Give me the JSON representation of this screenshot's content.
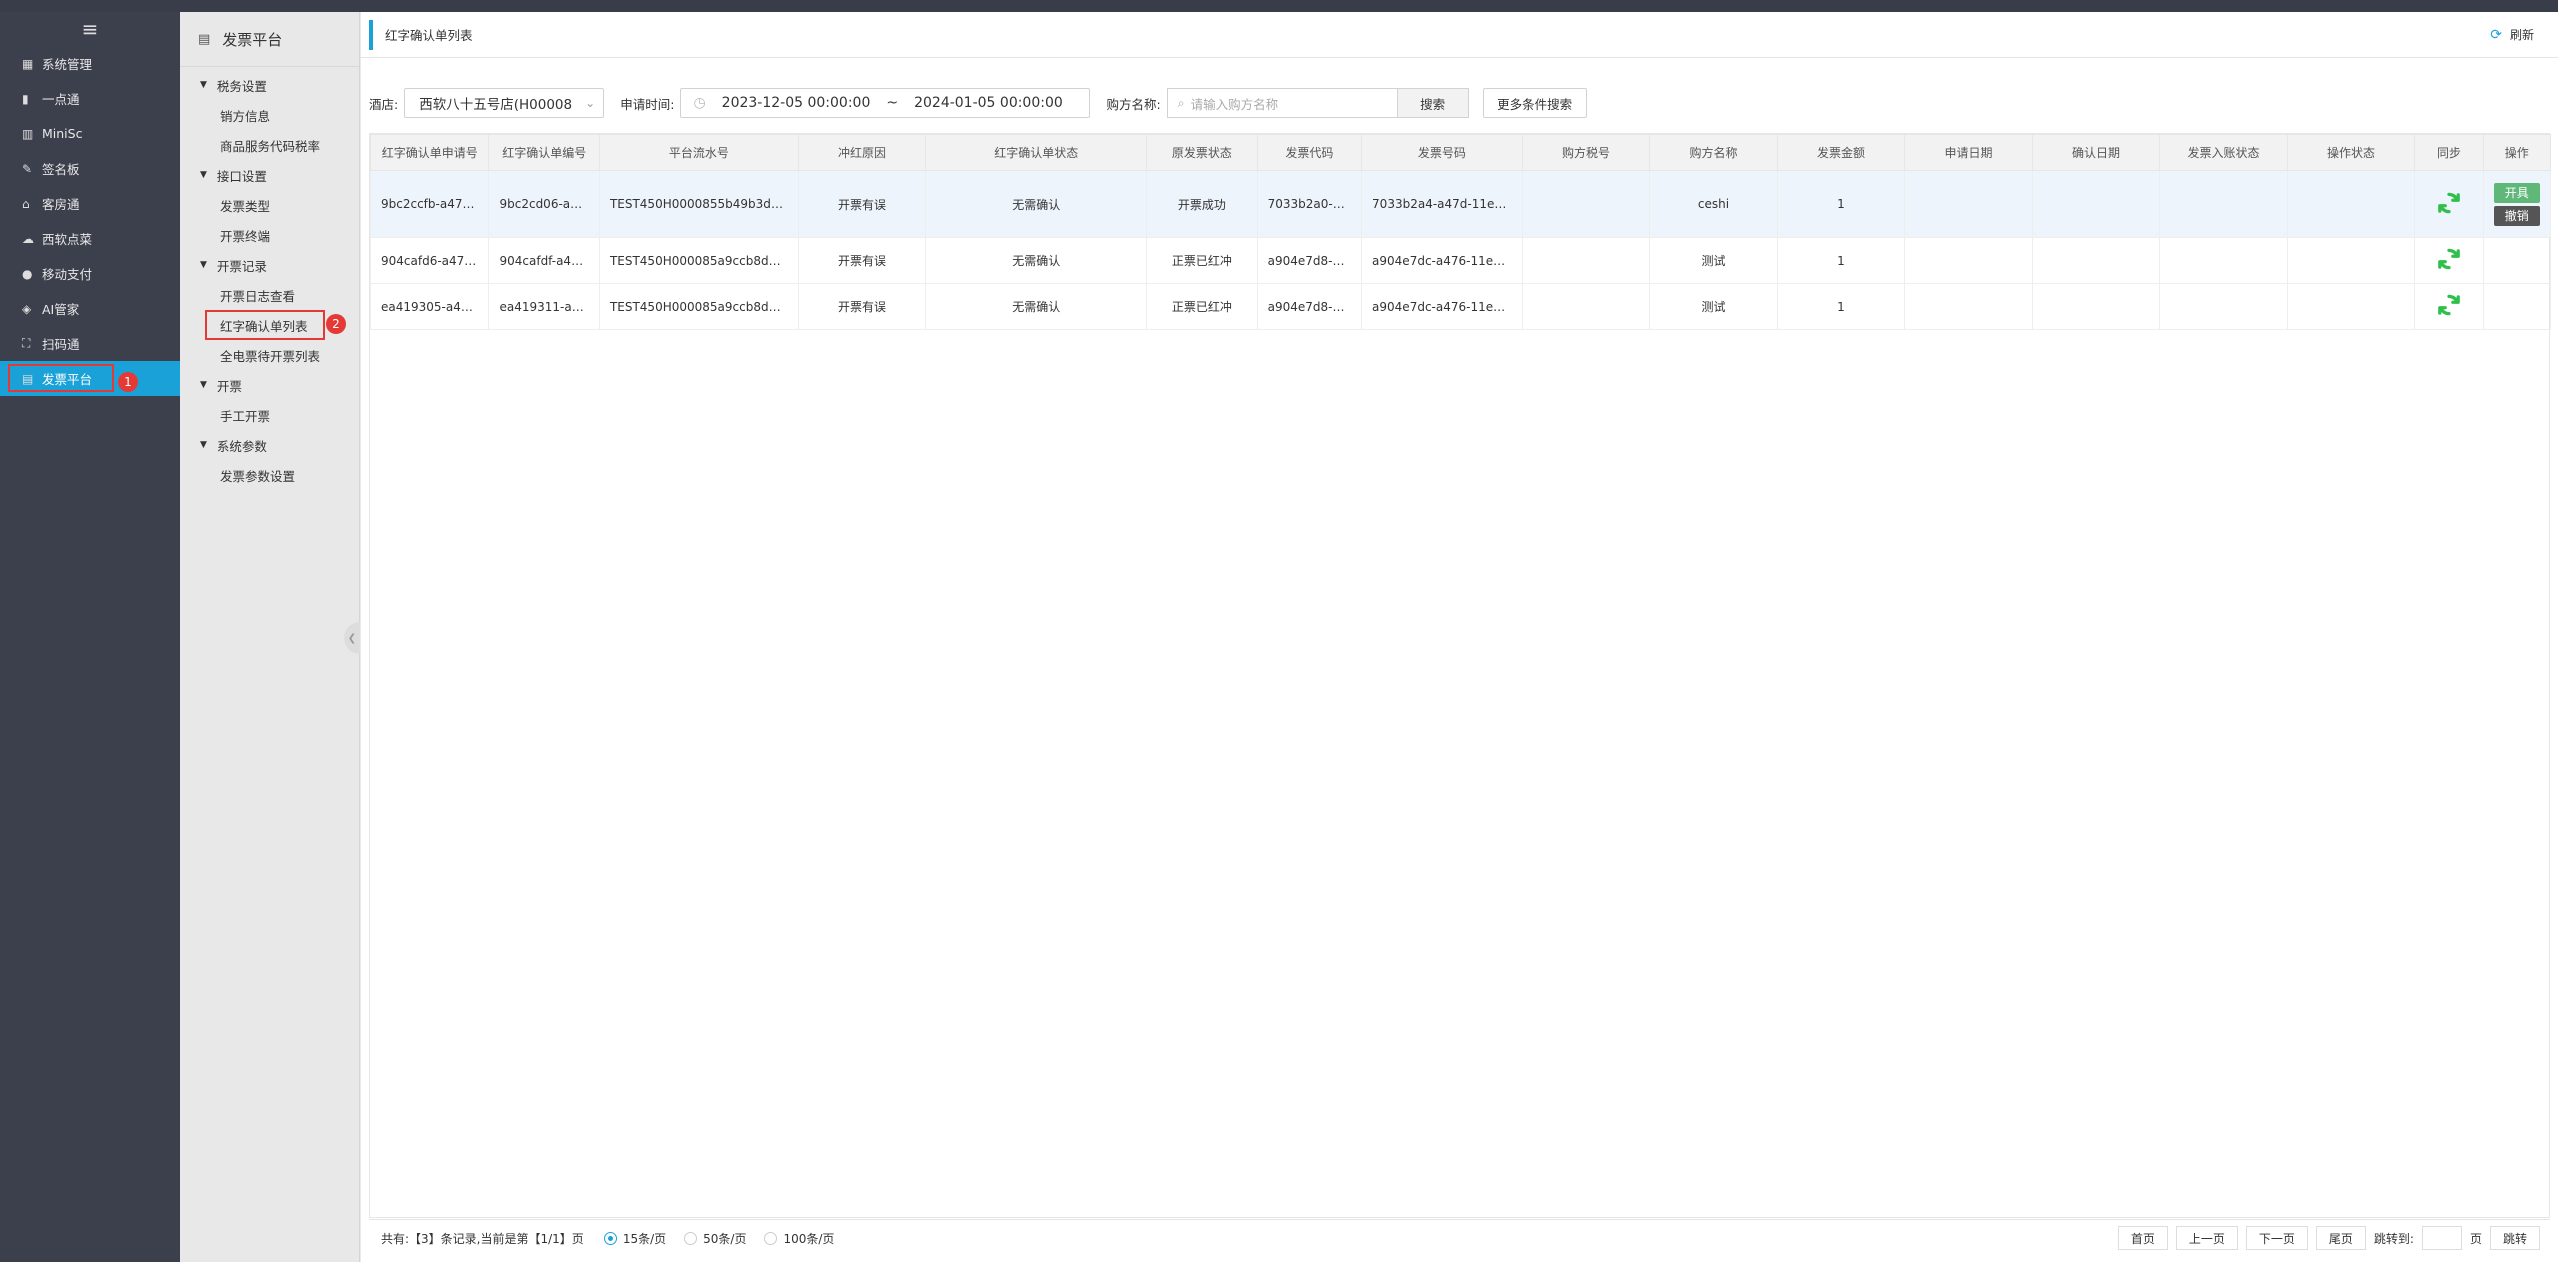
{
  "leftnav": {
    "menu_icon": "≡",
    "items": [
      {
        "icon": "grid-icon",
        "glyph": "▦",
        "label": "系统管理"
      },
      {
        "icon": "chart-icon",
        "glyph": "▮",
        "label": "一点通"
      },
      {
        "icon": "bars-icon",
        "glyph": "▥",
        "label": "MiniSc"
      },
      {
        "icon": "pen-icon",
        "glyph": "✎",
        "label": "签名板"
      },
      {
        "icon": "home-icon",
        "glyph": "⌂",
        "label": "客房通"
      },
      {
        "icon": "cloud-icon",
        "glyph": "☁",
        "label": "西软点菜"
      },
      {
        "icon": "mobile-pay-icon",
        "glyph": "●",
        "label": "移动支付"
      },
      {
        "icon": "ai-icon",
        "glyph": "◈",
        "label": "AI管家"
      },
      {
        "icon": "scan-icon",
        "glyph": "⛶",
        "label": "扫码通"
      },
      {
        "icon": "invoice-icon",
        "glyph": "▤",
        "label": "发票平台"
      }
    ],
    "active_badge": "1"
  },
  "subnav": {
    "title": "发票平台",
    "groups": [
      {
        "label": "税务设置",
        "items": [
          "销方信息",
          "商品服务代码税率"
        ]
      },
      {
        "label": "接口设置",
        "items": [
          "发票类型",
          "开票终端"
        ]
      },
      {
        "label": "开票记录",
        "items": [
          "开票日志查看",
          "红字确认单列表",
          "全电票待开票列表"
        ]
      },
      {
        "label": "开票",
        "items": [
          "手工开票"
        ]
      },
      {
        "label": "系统参数",
        "items": [
          "发票参数设置"
        ]
      }
    ],
    "active_badge": "2"
  },
  "tabbar": {
    "tab_label": "红字确认单列表",
    "refresh_label": "刷新"
  },
  "filters": {
    "hotel_label": "酒店:",
    "hotel_value": "西软八十五号店(H00008",
    "date_label": "申请时间:",
    "date_start": "2023-12-05 00:00:00",
    "date_sep": "~",
    "date_end": "2024-01-05 00:00:00",
    "buyer_label": "购方名称:",
    "buyer_placeholder": "请输入购方名称",
    "search_btn": "搜索",
    "more_btn": "更多条件搜索"
  },
  "table": {
    "headers": [
      "红字确认单申请号",
      "红字确认单编号",
      "平台流水号",
      "冲红原因",
      "红字确认单状态",
      "原发票状态",
      "发票代码",
      "发票号码",
      "购方税号",
      "购方名称",
      "发票金额",
      "申请日期",
      "确认日期",
      "发票入账状态",
      "操作状态",
      "同步",
      "操作"
    ],
    "rows": [
      [
        "9bc2ccfb-a47d...",
        "9bc2cd06-a4...",
        "TEST450H0000855b49b3dc-...",
        "开票有误",
        "无需确认",
        "开票成功",
        "7033b2a0-a47",
        "7033b2a4-a47d-11ee-a",
        "",
        "ceshi",
        "1",
        "",
        "",
        "",
        ""
      ],
      [
        "904cafd6-a476...",
        "904cafdf-a47...",
        "TEST450H000085a9ccb8d8-...",
        "开票有误",
        "无需确认",
        "正票已红冲",
        "a904e7d8-a47",
        "a904e7dc-a476-11ee-a",
        "",
        "测试",
        "1",
        "",
        "",
        "",
        ""
      ],
      [
        "ea419305-a469...",
        "ea419311-a4...",
        "TEST450H000085a9ccb8d8-...",
        "开票有误",
        "无需确认",
        "正票已红冲",
        "a904e7d8-a47",
        "a904e7dc-a476-11ee-a",
        "",
        "测试",
        "1",
        "",
        "",
        "",
        ""
      ]
    ],
    "op_open": "开具",
    "op_cancel": "撤销"
  },
  "pager": {
    "total_text": "共有:【3】条记录,当前是第【1/1】页",
    "size_15": "15条/页",
    "size_50": "50条/页",
    "size_100": "100条/页",
    "first": "首页",
    "prev": "上一页",
    "next": "下一页",
    "last": "尾页",
    "jump_label": "跳转到:",
    "page_unit": "页",
    "jump_btn": "跳转"
  },
  "colors": {
    "accent": "#1aa2d8",
    "sync_green": "#2fbf4a",
    "highlight_red": "#e53935"
  }
}
